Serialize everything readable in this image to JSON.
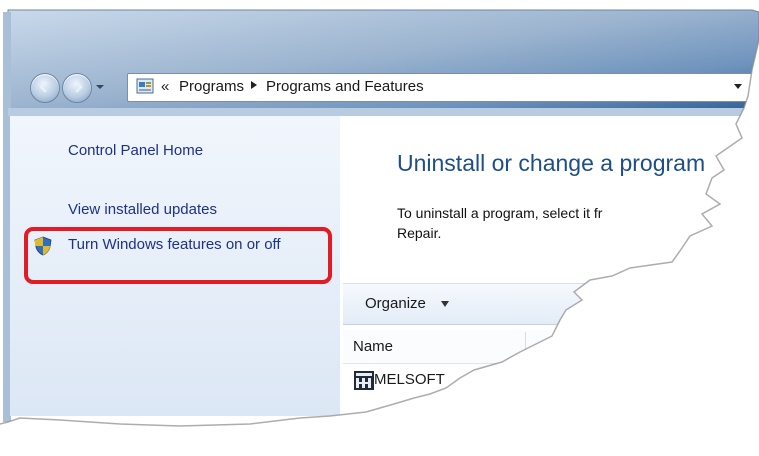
{
  "window": {
    "frame_color": "#9fb6d2",
    "glass_dark": "#2f5a8e"
  },
  "nav": {
    "back_icon": "back-arrow-icon",
    "forward_icon": "forward-arrow-icon"
  },
  "address_bar": {
    "chevrons": "«",
    "crumbs": [
      "Programs",
      "Programs and Features"
    ],
    "icon": "control-panel-icon"
  },
  "left_pane": {
    "links": [
      {
        "label": "Control Panel Home"
      },
      {
        "label": "View installed updates"
      },
      {
        "label": "Turn Windows features on or off",
        "icon": "uac-shield-icon"
      }
    ],
    "highlight_color": "#e21b24"
  },
  "content": {
    "title": "Uninstall or change a program",
    "description": "To uninstall a program, select it f… Repair.",
    "description_line1": "To uninstall a program, select it fr",
    "description_line2": "Repair."
  },
  "toolbar": {
    "organize_label": "Organize"
  },
  "list": {
    "columns": [
      "Name"
    ],
    "rows": [
      {
        "name": "MELSOFT",
        "icon": "melsoft-icon"
      }
    ]
  }
}
